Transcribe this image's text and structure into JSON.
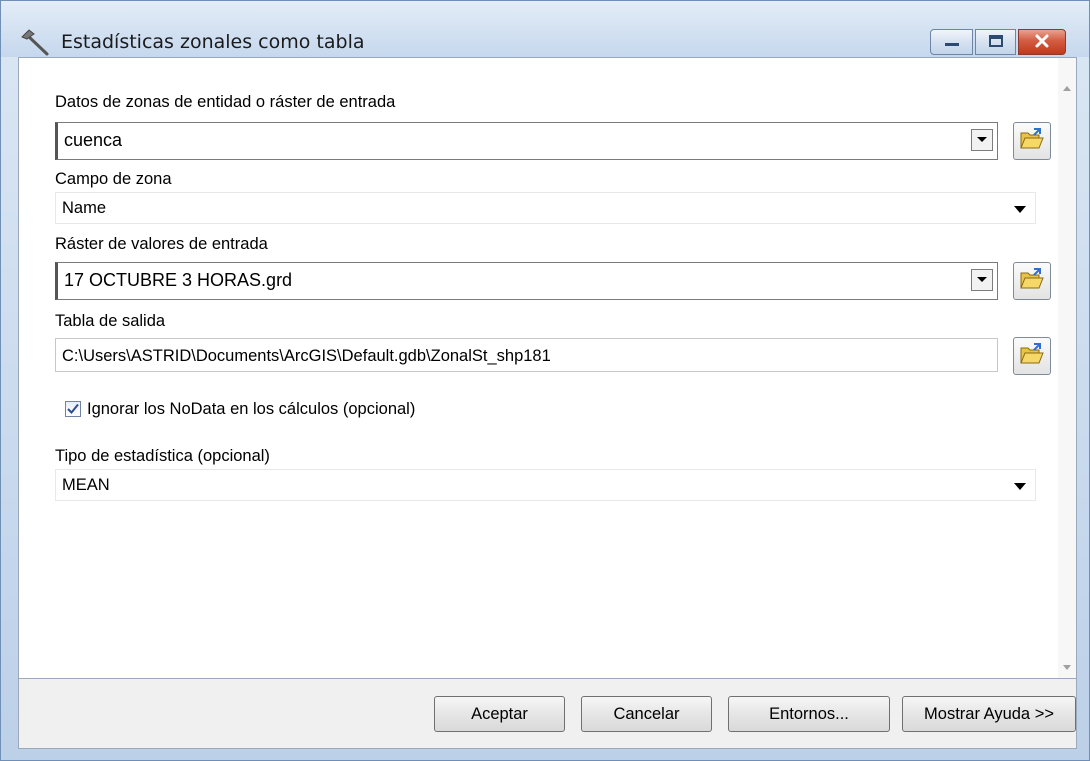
{
  "window": {
    "title": "Estadísticas zonales como tabla"
  },
  "fields": {
    "input_zone_label": "Datos de zonas de entidad o ráster de entrada",
    "input_zone_value": "cuenca",
    "zone_field_label": "Campo de zona",
    "zone_field_value": "Name",
    "value_raster_label": "Ráster de valores de entrada",
    "value_raster_value": "17 OCTUBRE 3 HORAS.grd",
    "output_table_label": "Tabla de salida",
    "output_table_value": "C:\\Users\\ASTRID\\Documents\\ArcGIS\\Default.gdb\\ZonalSt_shp181",
    "ignore_nodata_label": "Ignorar los NoData en los cálculos (opcional)",
    "ignore_nodata_checked": true,
    "stat_type_label": "Tipo de estadística (opcional)",
    "stat_type_value": "MEAN"
  },
  "buttons": {
    "ok": "Aceptar",
    "cancel": "Cancelar",
    "environments": "Entornos...",
    "show_help": "Mostrar Ayuda >>"
  },
  "icons": {
    "title": "hammer-icon",
    "browse": "folder-open-icon",
    "minimize": "minimize-icon",
    "maximize": "maximize-icon",
    "close": "close-icon"
  },
  "colors": {
    "close_button": "#c1391c",
    "title_bar": "#d4e2f2"
  }
}
